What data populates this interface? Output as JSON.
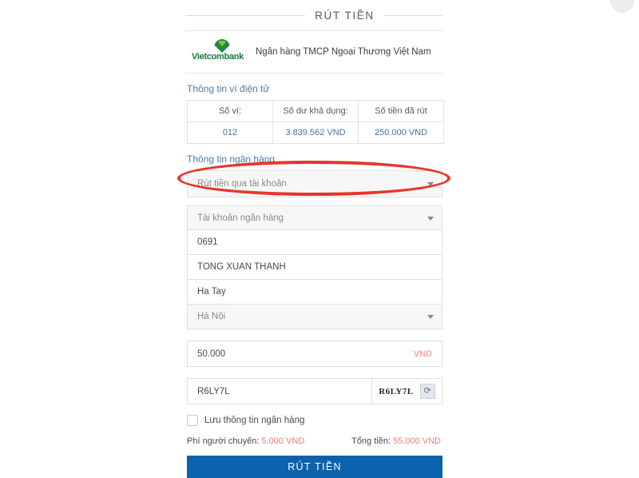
{
  "header": {
    "title": "RÚT TIỀN"
  },
  "bank": {
    "logo_wordmark": "Vietcombank",
    "name": "Ngân hàng TMCP Ngoại Thương Việt Nam"
  },
  "wallet_section": {
    "heading": "Thông tin ví điện tử",
    "columns": [
      "Số ví:",
      "Số dư khả dụng:",
      "Số tiền đã rút"
    ],
    "values": [
      "012",
      "3.839.562 VND",
      "250.000 VND"
    ]
  },
  "bank_section": {
    "heading": "Thông tin ngân hàng",
    "method_select": {
      "value": "Rút tiền qua tài khoản",
      "caret": "chevron-down-icon"
    },
    "account_select": {
      "placeholder": "Tài khoản ngân hàng",
      "caret": "chevron-down-icon"
    },
    "account_number": "0691",
    "account_holder": "TONG XUAN THANH",
    "branch": "Ha Tay",
    "province_select": {
      "value": "Hà Nội",
      "caret": "chevron-down-icon"
    }
  },
  "amount": {
    "value": "50.000",
    "unit": "VND"
  },
  "captcha": {
    "input_value": "R6LY7L",
    "image_text": "R6LY7L",
    "refresh_icon": "refresh-icon",
    "refresh_glyph": "⟳"
  },
  "save_info": {
    "label": "Lưu thông tin ngân hàng",
    "checked": false
  },
  "totals": {
    "fee_label": "Phí người chuyến:",
    "fee_value": "5.000 VND",
    "total_label": "Tổng tiền:",
    "total_value": "55.000 VND"
  },
  "submit": {
    "label": "RÚT TIỀN"
  },
  "colors": {
    "primary_blue": "#0b63ad",
    "section_heading": "#4a7aa8",
    "accent_red": "#ef7b72",
    "annotation_red": "#e8352a",
    "bank_green": "#0f7d3b"
  }
}
